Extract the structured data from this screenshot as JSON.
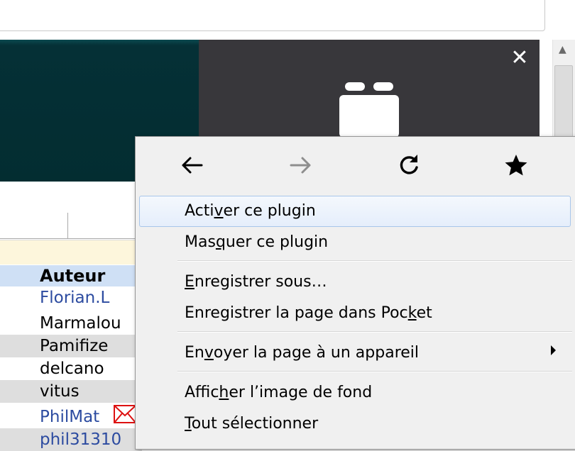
{
  "page": {
    "close_glyph": "✕",
    "table_header": "Auteur",
    "authors": [
      {
        "name": "Florian.L",
        "link": true
      },
      {
        "name": "Marmalou",
        "link": false
      },
      {
        "name": "Pamifize",
        "link": false
      },
      {
        "name": "delcano",
        "link": false
      },
      {
        "name": "vitus",
        "link": false
      },
      {
        "name": "PhilMat",
        "link": true
      },
      {
        "name": "phil31310",
        "link": true
      }
    ]
  },
  "menu": {
    "nav": {
      "back_icon": "arrow-left-icon",
      "forward_icon": "arrow-right-icon",
      "reload_icon": "reload-icon",
      "bookmark_icon": "star-icon"
    },
    "items": [
      {
        "pre": "Acti",
        "key": "v",
        "post": "er ce plugin"
      },
      {
        "pre": "Mas",
        "key": "q",
        "post": "uer ce plugin"
      },
      {
        "pre": "",
        "key": "E",
        "post": "nregistrer sous…"
      },
      {
        "pre": "Enregistrer la page dans Poc",
        "key": "k",
        "post": "et"
      },
      {
        "pre": "En",
        "key": "v",
        "post": "oyer la page à un appareil"
      },
      {
        "pre": "Affic",
        "key": "h",
        "post": "er l’image de fond"
      },
      {
        "pre": "",
        "key": "T",
        "post": "out sélectionner"
      }
    ]
  },
  "colors": {
    "banner_dark": "#032d31",
    "banner_grey": "#38373b",
    "link_blue": "#2c4ba0",
    "header_blue": "#cfe0f5",
    "highlight_border": "#a8c6ea"
  }
}
